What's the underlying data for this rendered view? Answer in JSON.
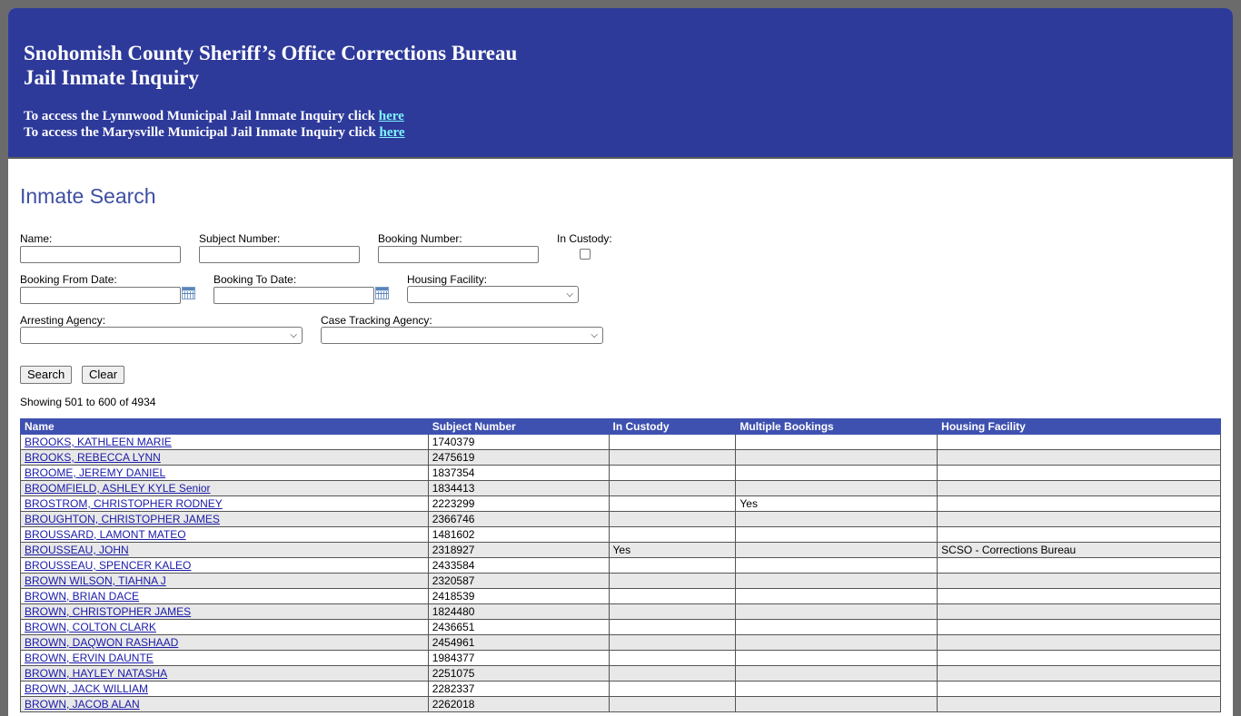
{
  "banner": {
    "title_line1": "Snohomish County Sheriff’s Office Corrections Bureau",
    "title_line2": "Jail Inmate Inquiry",
    "lynnwood_text": "To access the Lynnwood Municipal Jail Inmate Inquiry click ",
    "lynnwood_link": "here",
    "marysville_text": "To access the Marysville Municipal Jail Inmate Inquiry click ",
    "marysville_link": "here"
  },
  "search": {
    "heading": "Inmate Search",
    "name_label": "Name:",
    "subject_label": "Subject Number:",
    "booking_label": "Booking Number:",
    "custody_label": "In Custody:",
    "from_label": "Booking From Date:",
    "to_label": "Booking To Date:",
    "housing_label": "Housing Facility:",
    "arresting_label": "Arresting Agency:",
    "case_label": "Case Tracking Agency:",
    "search_button": "Search",
    "clear_button": "Clear",
    "showing": "Showing 501 to 600 of 4934"
  },
  "table": {
    "headers": [
      "Name",
      "Subject Number",
      "In Custody",
      "Multiple Bookings",
      "Housing Facility"
    ],
    "rows": [
      [
        "BROOKS, KATHLEEN MARIE",
        "1740379",
        "",
        "",
        ""
      ],
      [
        "BROOKS, REBECCA LYNN",
        "2475619",
        "",
        "",
        ""
      ],
      [
        "BROOME, JEREMY DANIEL",
        "1837354",
        "",
        "",
        ""
      ],
      [
        "BROOMFIELD, ASHLEY KYLE Senior",
        "1834413",
        "",
        "",
        ""
      ],
      [
        "BROSTROM, CHRISTOPHER RODNEY",
        "2223299",
        "",
        "Yes",
        ""
      ],
      [
        "BROUGHTON, CHRISTOPHER JAMES",
        "2366746",
        "",
        "",
        ""
      ],
      [
        "BROUSSARD, LAMONT MATEO",
        "1481602",
        "",
        "",
        ""
      ],
      [
        "BROUSSEAU, JOHN",
        "2318927",
        "Yes",
        "",
        "SCSO - Corrections Bureau"
      ],
      [
        "BROUSSEAU, SPENCER KALEO",
        "2433584",
        "",
        "",
        ""
      ],
      [
        "BROWN WILSON, TIAHNA J",
        "2320587",
        "",
        "",
        ""
      ],
      [
        "BROWN, BRIAN DACE",
        "2418539",
        "",
        "",
        ""
      ],
      [
        "BROWN, CHRISTOPHER JAMES",
        "1824480",
        "",
        "",
        ""
      ],
      [
        "BROWN, COLTON CLARK",
        "2436651",
        "",
        "",
        ""
      ],
      [
        "BROWN, DAQWON RASHAAD",
        "2454961",
        "",
        "",
        ""
      ],
      [
        "BROWN, ERVIN DAUNTE",
        "1984377",
        "",
        "",
        ""
      ],
      [
        "BROWN, HAYLEY NATASHA",
        "2251075",
        "",
        "",
        ""
      ],
      [
        "BROWN, JACK WILLIAM",
        "2282337",
        "",
        "",
        ""
      ],
      [
        "BROWN, JACOB ALAN",
        "2262018",
        "",
        "",
        ""
      ]
    ]
  }
}
